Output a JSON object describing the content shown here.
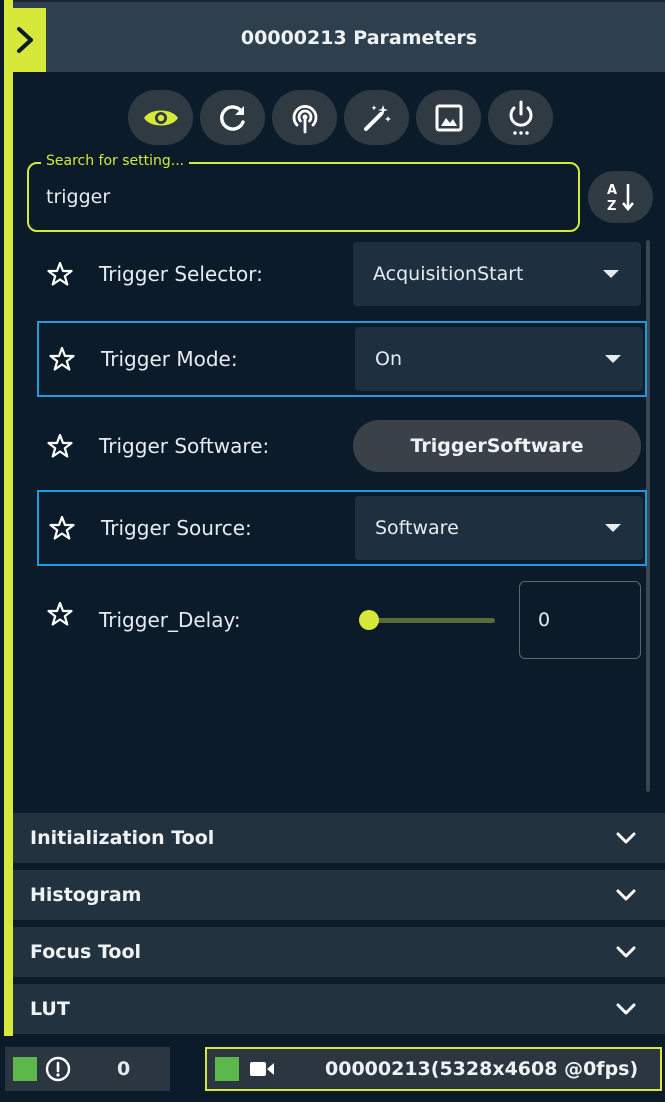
{
  "header": {
    "title": "00000213 Parameters"
  },
  "toolbar": {
    "buttons": [
      {
        "icon": "eye-icon",
        "color": "#d6e83a"
      },
      {
        "icon": "refresh-icon"
      },
      {
        "icon": "broadcast-icon"
      },
      {
        "icon": "magic-wand-icon"
      },
      {
        "icon": "image-icon"
      },
      {
        "icon": "power-icon"
      }
    ]
  },
  "search": {
    "label": "Search for setting...",
    "value": "trigger"
  },
  "sort": {
    "icon": "sort-az-icon"
  },
  "params": [
    {
      "label": "Trigger Selector:",
      "type": "dropdown",
      "value": "AcquisitionStart",
      "highlighted": false
    },
    {
      "label": "Trigger Mode:",
      "type": "dropdown",
      "value": "On",
      "highlighted": true
    },
    {
      "label": "Trigger Software:",
      "type": "button",
      "value": "TriggerSoftware",
      "highlighted": false
    },
    {
      "label": "Trigger Source:",
      "type": "dropdown",
      "value": "Software",
      "highlighted": true
    },
    {
      "label": "Trigger_Delay:",
      "type": "slider",
      "value": "0",
      "slider_fraction": 0,
      "highlighted": false
    }
  ],
  "sections": [
    {
      "label": "Initialization Tool"
    },
    {
      "label": "Histogram"
    },
    {
      "label": "Focus Tool"
    },
    {
      "label": "LUT"
    }
  ],
  "status": {
    "alert_count": "0",
    "camera_info": "00000213(5328x4608 @0fps)"
  },
  "colors": {
    "accent": "#d6e83a",
    "highlight_border": "#1e9be0",
    "status_green": "#5cb84a",
    "background": "#0b1b2a"
  }
}
